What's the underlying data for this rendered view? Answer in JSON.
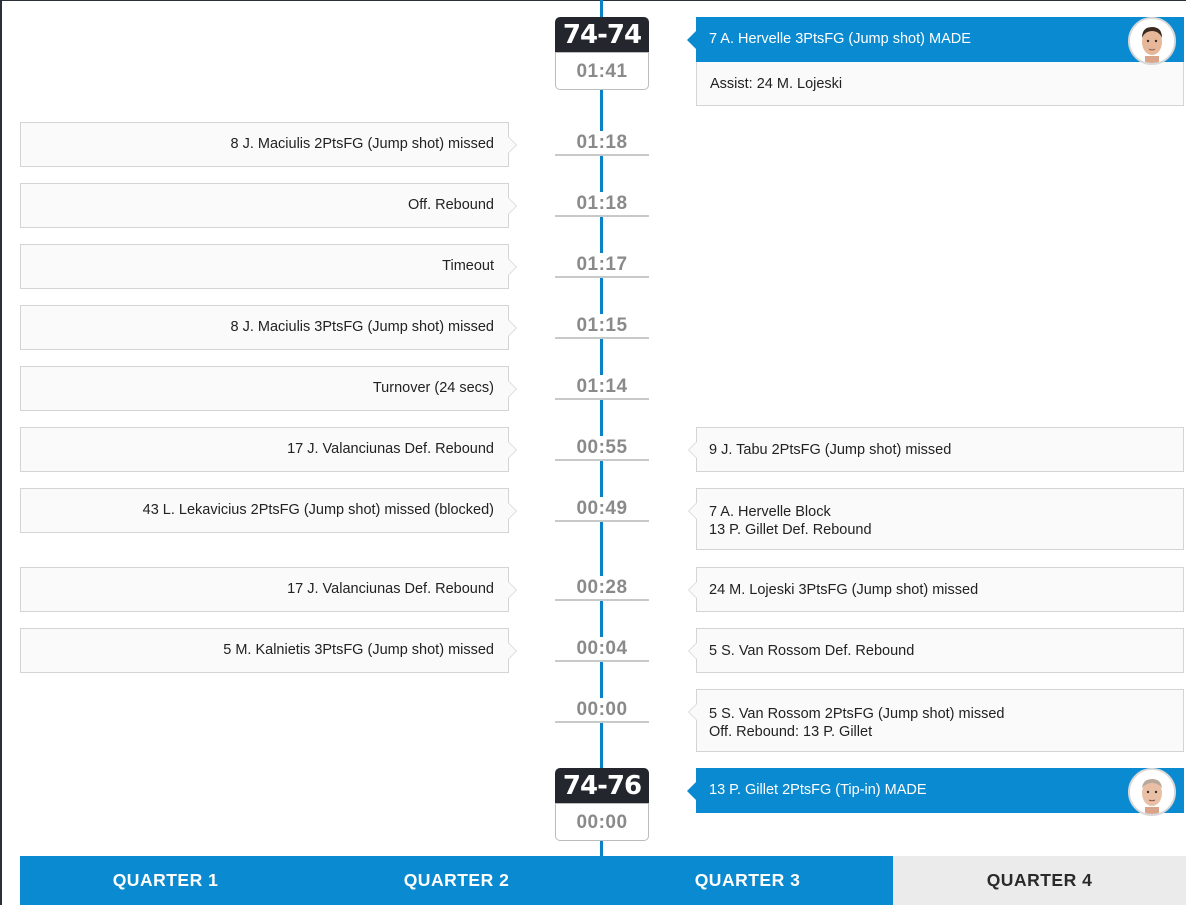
{
  "scores": [
    "74-74",
    "74-76"
  ],
  "made_events": [
    {
      "text": "7 A. Hervelle 3PtsFG (Jump shot) MADE",
      "sub": "Assist: 24 M. Lojeski"
    },
    {
      "text": "13 P. Gillet 2PtsFG (Tip-in) MADE",
      "sub": ""
    }
  ],
  "times": [
    "01:41",
    "01:18",
    "01:18",
    "01:17",
    "01:15",
    "01:14",
    "00:55",
    "00:49",
    "00:28",
    "00:04",
    "00:00",
    "00:00"
  ],
  "left_events": [
    "8 J. Maciulis 2PtsFG (Jump shot) missed",
    "Off. Rebound",
    "Timeout",
    "8 J. Maciulis 3PtsFG (Jump shot) missed",
    "Turnover (24 secs)",
    "17 J. Valanciunas Def. Rebound",
    "43 L. Lekavicius 2PtsFG (Jump shot) missed (blocked)",
    "17 J. Valanciunas Def. Rebound",
    "5 M. Kalnietis 3PtsFG (Jump shot) missed"
  ],
  "right_events": [
    {
      "line1": "9 J. Tabu 2PtsFG (Jump shot) missed",
      "line2": ""
    },
    {
      "line1": "7 A. Hervelle Block",
      "line2": "13 P. Gillet Def. Rebound"
    },
    {
      "line1": "24 M. Lojeski 3PtsFG (Jump shot) missed",
      "line2": ""
    },
    {
      "line1": "5 S. Van Rossom Def. Rebound",
      "line2": ""
    },
    {
      "line1": "5 S. Van Rossom 2PtsFG (Jump shot) missed",
      "line2": "Off. Rebound: 13 P. Gillet"
    }
  ],
  "tabs": [
    "QUARTER 1",
    "QUARTER 2",
    "QUARTER 3",
    "QUARTER 4"
  ],
  "active_tab": "QUARTER 4",
  "colors": {
    "accent": "#0a8ad0",
    "score_bg": "#23262d",
    "timeline": "#0a82c8"
  },
  "icons": {
    "avatar": "player-portrait-icon"
  }
}
